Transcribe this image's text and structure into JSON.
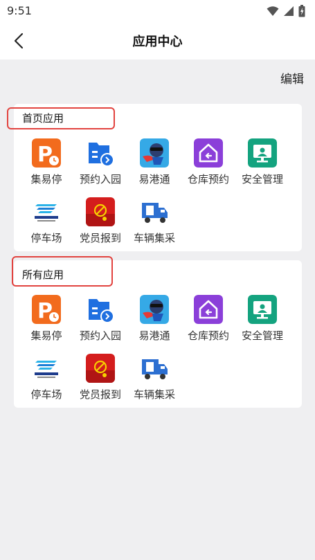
{
  "status_bar": {
    "time": "9:51"
  },
  "header": {
    "title": "应用中心"
  },
  "toolbar": {
    "edit_label": "编辑"
  },
  "sections": [
    {
      "title": "首页应用",
      "apps": [
        {
          "label": "集易停",
          "icon": "parking-p-icon",
          "color": "#f26b1d"
        },
        {
          "label": "预约入园",
          "icon": "reservation-entry-icon",
          "color": "#1f6fe0"
        },
        {
          "label": "易港通",
          "icon": "mascot-icon",
          "color": "#35a9e6"
        },
        {
          "label": "仓库预约",
          "icon": "warehouse-icon",
          "color": "#8b3fd9"
        },
        {
          "label": "安全管理",
          "icon": "safety-monitor-icon",
          "color": "#14a37f"
        },
        {
          "label": "停车场",
          "icon": "port-logo-icon",
          "color": "#1b7fd6"
        },
        {
          "label": "党员报到",
          "icon": "party-emblem-icon",
          "color": "#d41d1d"
        },
        {
          "label": "车辆集采",
          "icon": "truck-icon",
          "color": "#2c6fd1"
        }
      ]
    },
    {
      "title": "所有应用",
      "apps": [
        {
          "label": "集易停",
          "icon": "parking-p-icon",
          "color": "#f26b1d"
        },
        {
          "label": "预约入园",
          "icon": "reservation-entry-icon",
          "color": "#1f6fe0"
        },
        {
          "label": "易港通",
          "icon": "mascot-icon",
          "color": "#35a9e6"
        },
        {
          "label": "仓库预约",
          "icon": "warehouse-icon",
          "color": "#8b3fd9"
        },
        {
          "label": "安全管理",
          "icon": "safety-monitor-icon",
          "color": "#14a37f"
        },
        {
          "label": "停车场",
          "icon": "port-logo-icon",
          "color": "#1b7fd6"
        },
        {
          "label": "党员报到",
          "icon": "party-emblem-icon",
          "color": "#d41d1d"
        },
        {
          "label": "车辆集采",
          "icon": "truck-icon",
          "color": "#2c6fd1"
        }
      ]
    }
  ],
  "colors": {
    "highlight": "#e2433f",
    "background": "#efeff1"
  }
}
